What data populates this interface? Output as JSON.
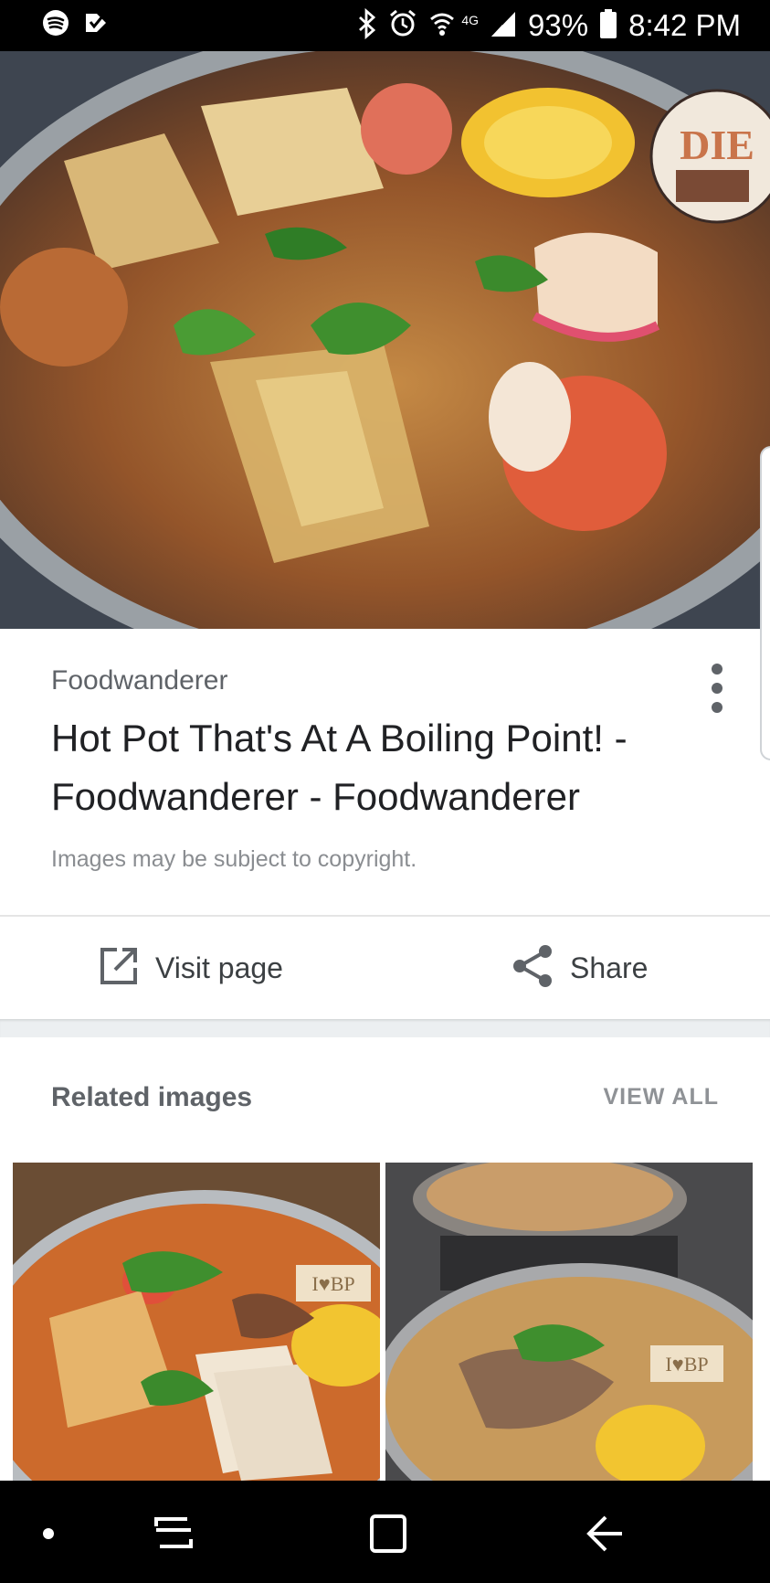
{
  "status_bar": {
    "battery": "93%",
    "time": "8:42 PM",
    "network": "4G",
    "icons": [
      "spotify-icon",
      "tasker-check-icon",
      "bluetooth-icon",
      "alarm-icon",
      "wifi-icon",
      "signal-icon",
      "battery-icon"
    ]
  },
  "result": {
    "source": "Foodwanderer",
    "title": "Hot Pot That's At A Boiling Point! - Foodwanderer - Foodwanderer",
    "copyright": "Images may be subject to copyright.",
    "image_badge_text": "DIE"
  },
  "actions": {
    "visit_label": "Visit page",
    "share_label": "Share"
  },
  "related": {
    "title": "Related images",
    "view_all": "VIEW ALL",
    "thumb_badges": [
      "I♥BP",
      "I♥BP"
    ]
  },
  "nav": {
    "icons": [
      "dot-icon",
      "recent-apps-icon",
      "home-icon",
      "back-icon"
    ]
  },
  "colors": {
    "title": "#202124",
    "secondary": "#5f6368",
    "status_bg": "#000000",
    "nav_bg": "#000000"
  }
}
